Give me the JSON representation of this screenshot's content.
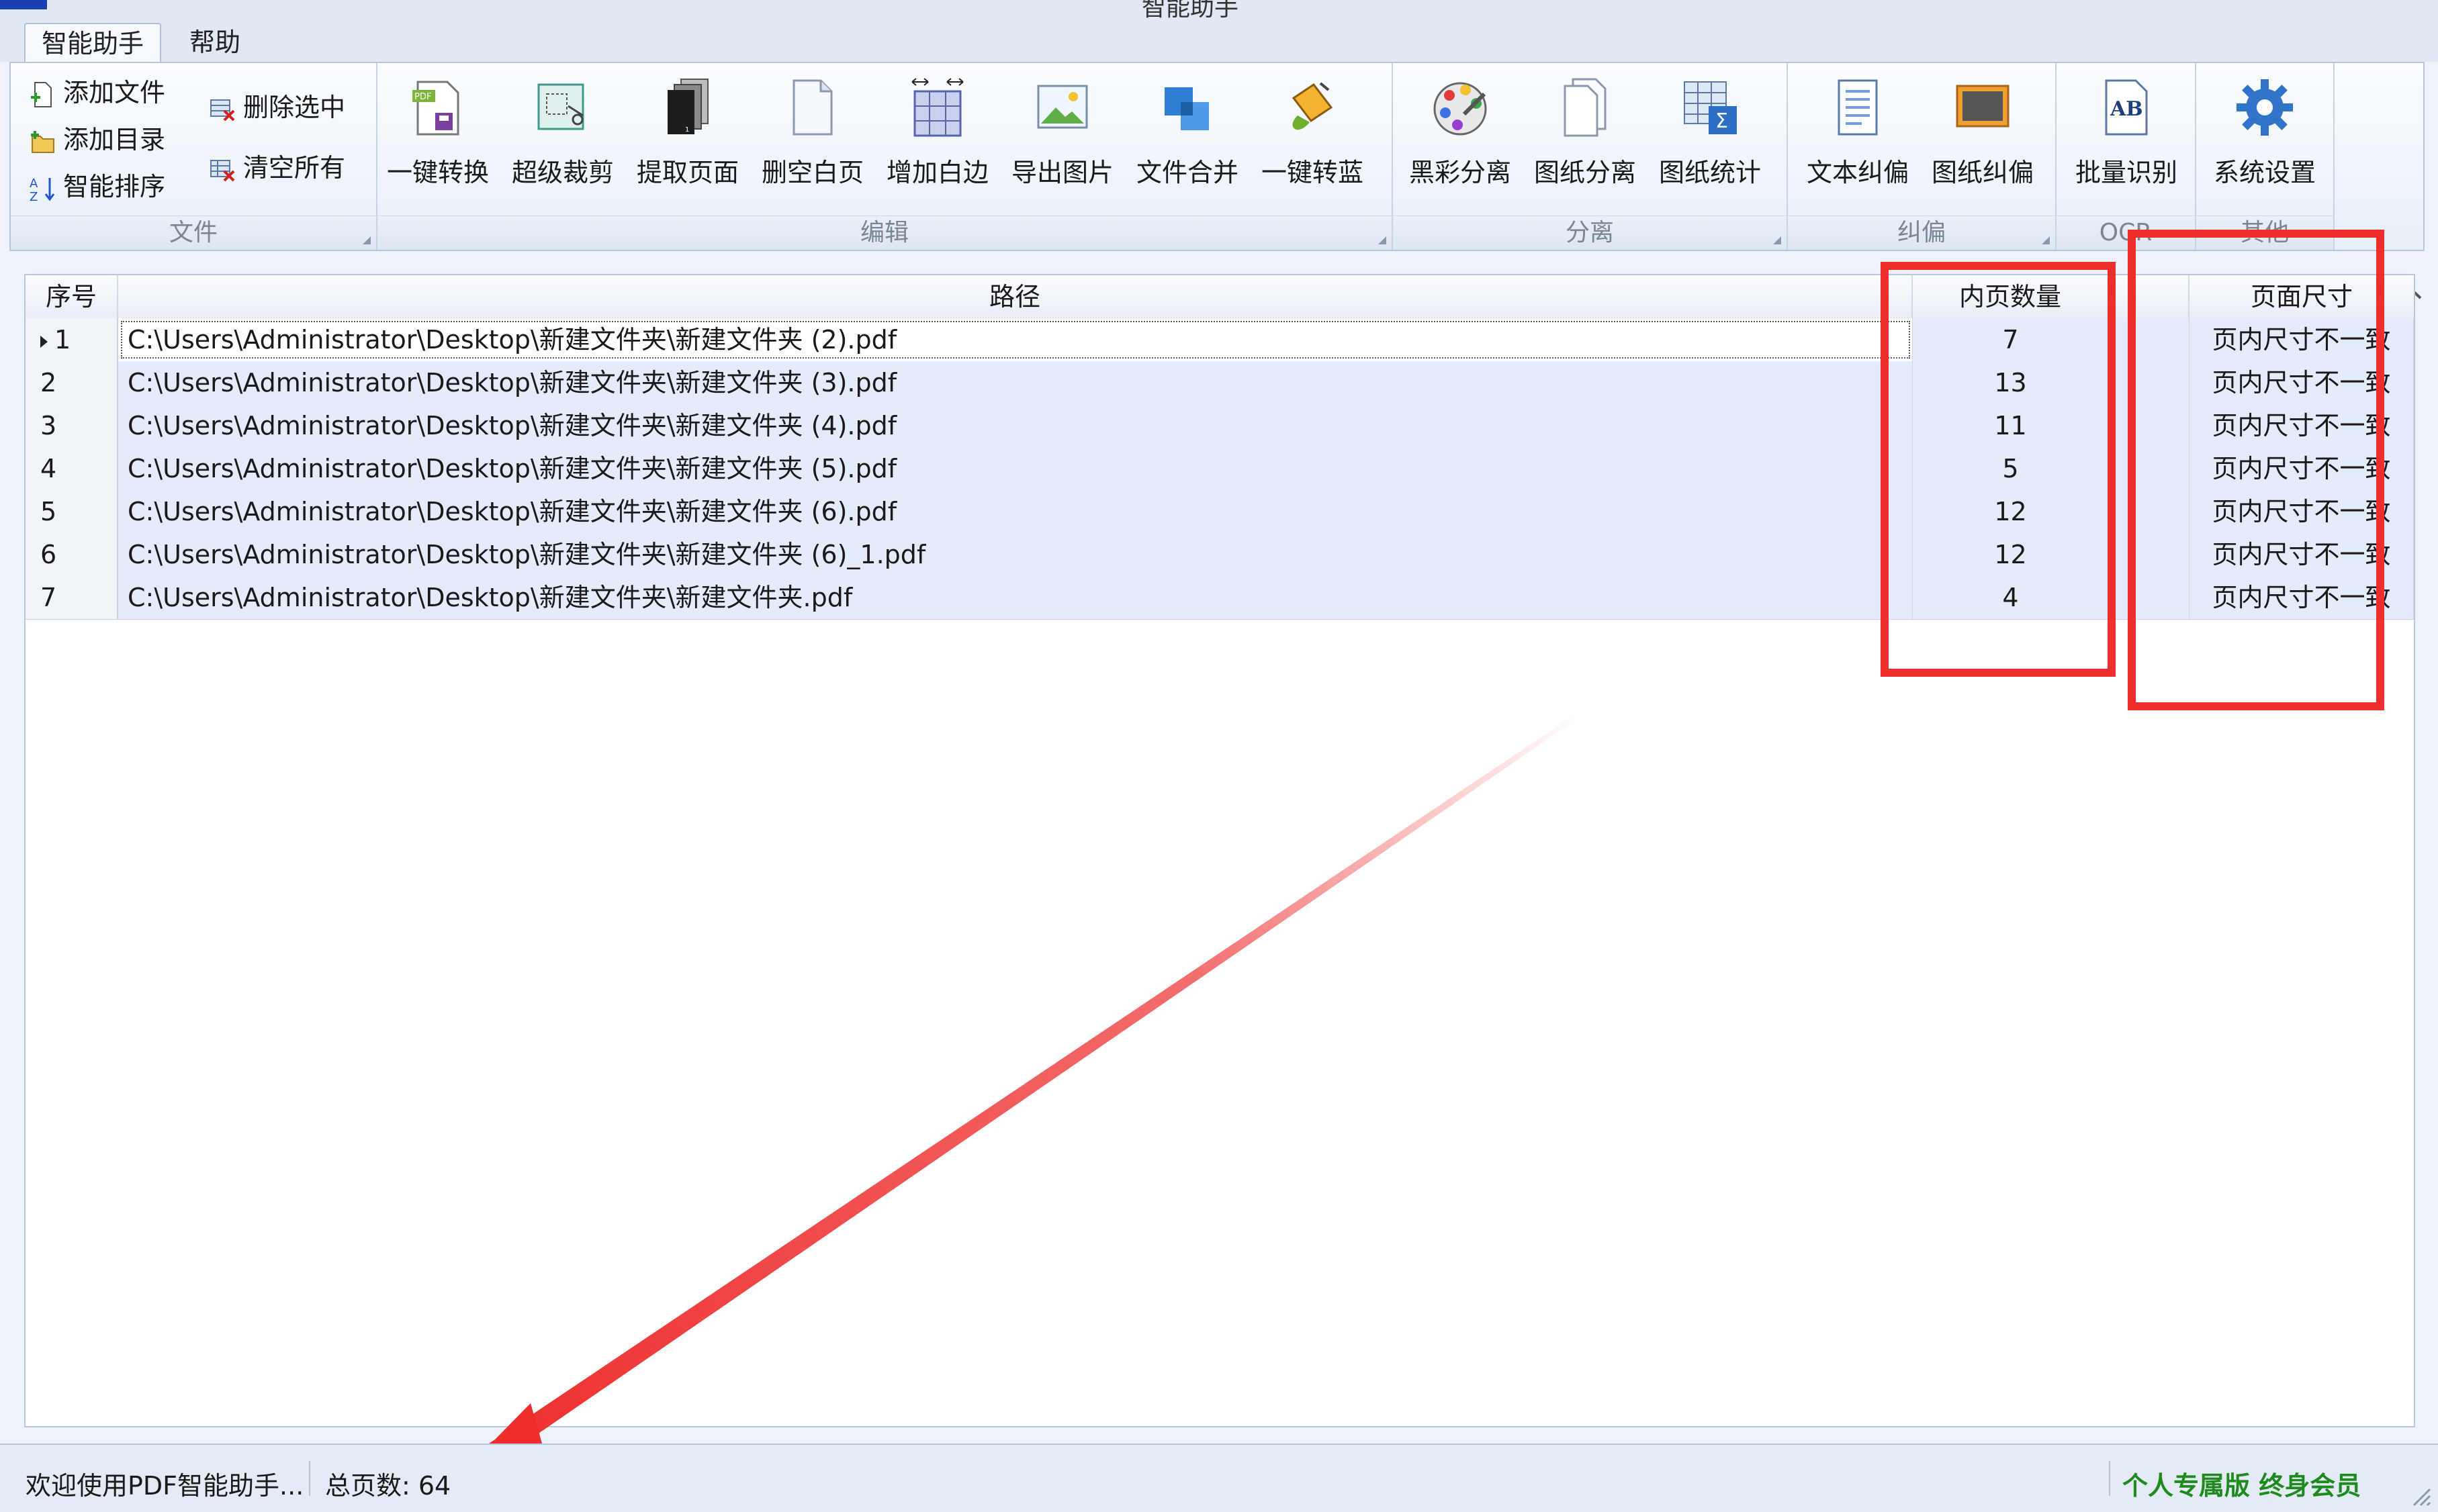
{
  "window": {
    "title": "智能助手"
  },
  "tabs": [
    {
      "label": "智能助手",
      "active": true
    },
    {
      "label": "帮助",
      "active": false
    }
  ],
  "ribbon": {
    "groups": {
      "file": "文件",
      "edit": "编辑",
      "separate": "分离",
      "deskew": "纠偏",
      "ocr": "OCR",
      "other": "其他"
    },
    "file_buttons": {
      "add_file": "添加文件",
      "add_dir": "添加目录",
      "smart_sort": "智能排序",
      "delete_selected": "删除选中",
      "clear_all": "清空所有"
    },
    "edit_buttons": {
      "one_click_convert": "一键转换",
      "super_crop": "超级裁剪",
      "extract_pages": "提取页面",
      "delete_blank": "删空白页",
      "add_margin": "增加白边",
      "export_images": "导出图片",
      "merge_files": "文件合并",
      "one_click_blue": "一键转蓝"
    },
    "separate_buttons": {
      "bw_color_separate": "黑彩分离",
      "drawing_separate": "图纸分离",
      "drawing_stats": "图纸统计"
    },
    "deskew_buttons": {
      "text_deskew": "文本纠偏",
      "drawing_deskew": "图纸纠偏"
    },
    "ocr_buttons": {
      "batch_recognize": "批量识别",
      "ab_glyph": "AB"
    },
    "other_buttons": {
      "settings": "系统设置"
    }
  },
  "grid": {
    "columns": {
      "index": "序号",
      "path": "路径",
      "page_count": "内页数量",
      "page_size": "页面尺寸"
    },
    "rows": [
      {
        "index": "1",
        "path": "C:\\Users\\Administrator\\Desktop\\新建文件夹\\新建文件夹 (2).pdf",
        "page_count": "7",
        "page_size": "页内尺寸不一致"
      },
      {
        "index": "2",
        "path": "C:\\Users\\Administrator\\Desktop\\新建文件夹\\新建文件夹 (3).pdf",
        "page_count": "13",
        "page_size": "页内尺寸不一致"
      },
      {
        "index": "3",
        "path": "C:\\Users\\Administrator\\Desktop\\新建文件夹\\新建文件夹 (4).pdf",
        "page_count": "11",
        "page_size": "页内尺寸不一致"
      },
      {
        "index": "4",
        "path": "C:\\Users\\Administrator\\Desktop\\新建文件夹\\新建文件夹 (5).pdf",
        "page_count": "5",
        "page_size": "页内尺寸不一致"
      },
      {
        "index": "5",
        "path": "C:\\Users\\Administrator\\Desktop\\新建文件夹\\新建文件夹 (6).pdf",
        "page_count": "12",
        "page_size": "页内尺寸不一致"
      },
      {
        "index": "6",
        "path": "C:\\Users\\Administrator\\Desktop\\新建文件夹\\新建文件夹 (6)_1.pdf",
        "page_count": "12",
        "page_size": "页内尺寸不一致"
      },
      {
        "index": "7",
        "path": "C:\\Users\\Administrator\\Desktop\\新建文件夹\\新建文件夹.pdf",
        "page_count": "4",
        "page_size": "页内尺寸不一致"
      }
    ]
  },
  "status": {
    "welcome": "欢迎使用PDF智能助手...",
    "total_pages": "总页数: 64",
    "edition": "个人专属版 终身会员"
  },
  "colors": {
    "annotation": "#ee2d2d",
    "row_selected": "#e4ebfb",
    "edition_text": "#1f8a1f"
  }
}
